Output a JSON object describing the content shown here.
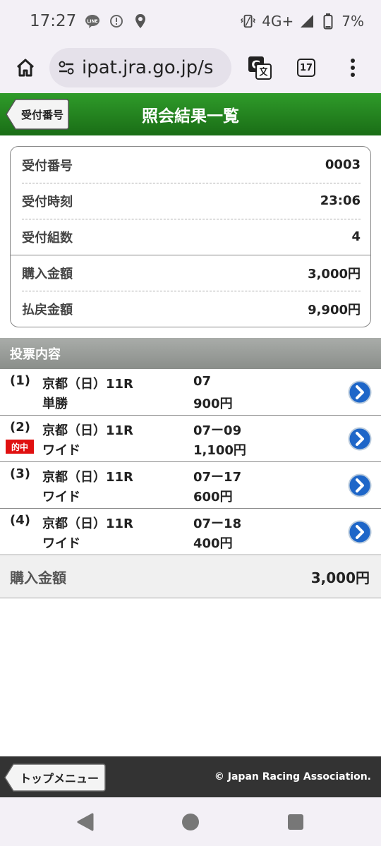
{
  "status_bar": {
    "time": "17:27",
    "app_icon_text": "LINE",
    "network": "4G+",
    "battery": "7%"
  },
  "browser": {
    "url": "ipat.jra.go.jp/s",
    "tab_count": "17"
  },
  "header": {
    "title": "照会結果一覧",
    "back_label": "受付番号"
  },
  "summary": {
    "rows": [
      {
        "label": "受付番号",
        "value": "0003"
      },
      {
        "label": "受付時刻",
        "value": "23:06"
      },
      {
        "label": "受付組数",
        "value": "4"
      },
      {
        "label": "購入金額",
        "value": "3,000円"
      },
      {
        "label": "払戻金額",
        "value": "9,900円"
      }
    ]
  },
  "votes": {
    "section_title": "投票内容",
    "hit_label": "的中",
    "items": [
      {
        "num": "(1)",
        "race": "京都（日）11R",
        "type": "単勝",
        "combo": "07",
        "amount": "900円",
        "hit": false
      },
      {
        "num": "(2)",
        "race": "京都（日）11R",
        "type": "ワイド",
        "combo": "07ー09",
        "amount": "1,100円",
        "hit": true
      },
      {
        "num": "(3)",
        "race": "京都（日）11R",
        "type": "ワイド",
        "combo": "07ー17",
        "amount": "600円",
        "hit": false
      },
      {
        "num": "(4)",
        "race": "京都（日）11R",
        "type": "ワイド",
        "combo": "07ー18",
        "amount": "400円",
        "hit": false
      }
    ]
  },
  "total": {
    "label": "購入金額",
    "value": "3,000円"
  },
  "footer": {
    "top_menu_label": "トップメニュー",
    "copyright": "© Japan Racing Association."
  },
  "colors": {
    "header_green": "#2f9b2a",
    "hit_red": "#e01010",
    "detail_blue": "#1e66c8"
  }
}
